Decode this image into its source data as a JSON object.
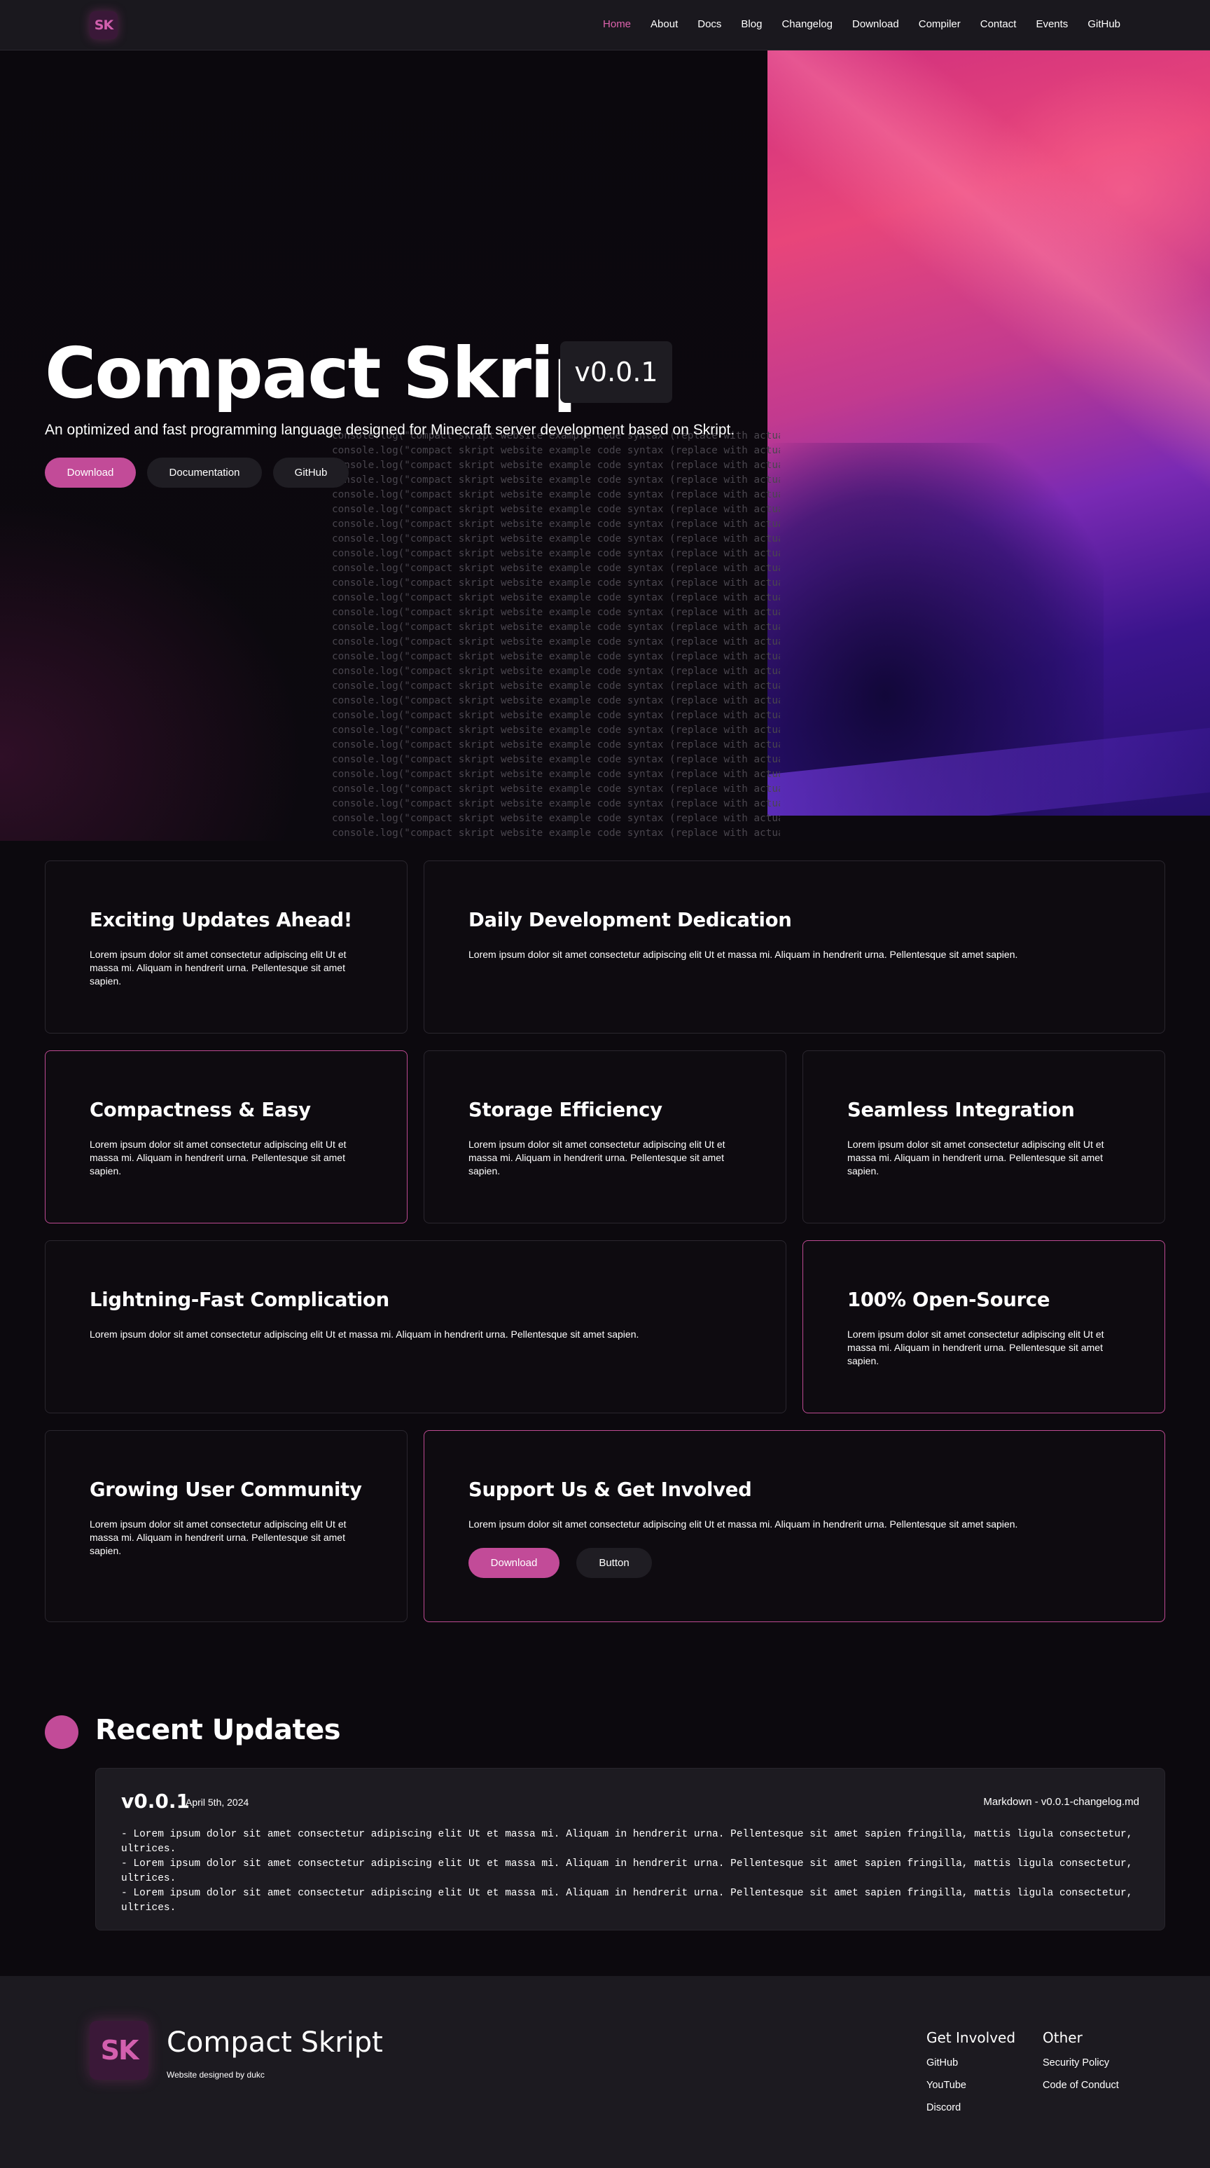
{
  "nav": {
    "logo": "SK",
    "links": [
      "Home",
      "About",
      "Docs",
      "Blog",
      "Changelog",
      "Download",
      "Compiler",
      "Contact",
      "Events",
      "GitHub"
    ],
    "active": "Home"
  },
  "hero": {
    "title": "Compact Skript",
    "version": "v0.0.1",
    "subtitle": "An optimized and fast programming language designed for Minecraft server development based on Skript.",
    "buttons": {
      "download": "Download",
      "documentation": "Documentation",
      "github": "GitHub"
    },
    "code_line": "console.log(\"compact skript website example code syntax (replace with actual  skript syntax?))"
  },
  "cards": [
    {
      "title": "Exciting Updates Ahead!",
      "text": "Lorem ipsum dolor sit amet consectetur adipiscing elit Ut et massa mi. Aliquam in hendrerit urna. Pellentesque sit amet sapien."
    },
    {
      "title": "Daily Development Dedication",
      "text": "Lorem ipsum dolor sit amet consectetur adipiscing elit Ut et massa mi. Aliquam in hendrerit urna. Pellentesque sit amet sapien."
    },
    {
      "title": "Compactness & Easy",
      "text": "Lorem ipsum dolor sit amet consectetur adipiscing elit Ut et massa mi. Aliquam in hendrerit urna. Pellentesque sit amet sapien."
    },
    {
      "title": "Storage Efficiency",
      "text": "Lorem ipsum dolor sit amet consectetur adipiscing elit Ut et massa mi. Aliquam in hendrerit urna. Pellentesque sit amet sapien."
    },
    {
      "title": "Seamless Integration",
      "text": "Lorem ipsum dolor sit amet consectetur adipiscing elit Ut et massa mi. Aliquam in hendrerit urna. Pellentesque sit amet sapien."
    },
    {
      "title": "Lightning-Fast Complication",
      "text": "Lorem ipsum dolor sit amet consectetur adipiscing elit Ut et massa mi. Aliquam in hendrerit urna. Pellentesque sit amet sapien."
    },
    {
      "title": "100% Open-Source",
      "text": "Lorem ipsum dolor sit amet consectetur adipiscing elit Ut et massa mi. Aliquam in hendrerit urna. Pellentesque sit amet sapien."
    },
    {
      "title": "Growing User Community",
      "text": "Lorem ipsum dolor sit amet consectetur adipiscing elit Ut et massa mi. Aliquam in hendrerit urna. Pellentesque sit amet sapien."
    },
    {
      "title": "Support Us & Get Involved",
      "text": "Lorem ipsum dolor sit amet consectetur adipiscing elit Ut et massa mi. Aliquam in hendrerit urna. Pellentesque sit amet sapien.",
      "buttons": [
        "Download",
        "Button"
      ]
    }
  ],
  "updates": {
    "title": "Recent Updates",
    "version": "v0.0.1",
    "date": "April 5th, 2024",
    "file": "Markdown - v0.0.1-changelog.md",
    "lines": [
      "- Lorem ipsum dolor sit amet consectetur adipiscing elit Ut et massa mi. Aliquam in hendrerit urna. Pellentesque sit amet sapien fringilla, mattis ligula consectetur, ultrices.",
      "- Lorem ipsum dolor sit amet consectetur adipiscing elit Ut et massa mi. Aliquam in hendrerit urna. Pellentesque sit amet sapien fringilla, mattis ligula consectetur, ultrices.",
      "- Lorem ipsum dolor sit amet consectetur adipiscing elit Ut et massa mi. Aliquam in hendrerit urna. Pellentesque sit amet sapien fringilla, mattis ligula consectetur, ultrices."
    ]
  },
  "footer": {
    "logo": "SK",
    "name": "Compact Skript",
    "credit": "Website designed by dukc",
    "get_involved": {
      "title": "Get Involved",
      "links": [
        "GitHub",
        "YouTube",
        "Discord"
      ]
    },
    "other": {
      "title": "Other",
      "links": [
        "Security Policy",
        "Code of Conduct"
      ]
    }
  },
  "colors": {
    "accent": "#c24b98",
    "background": "#0c090e",
    "card_border": "#2a262e",
    "footer": "#1c1a20"
  }
}
